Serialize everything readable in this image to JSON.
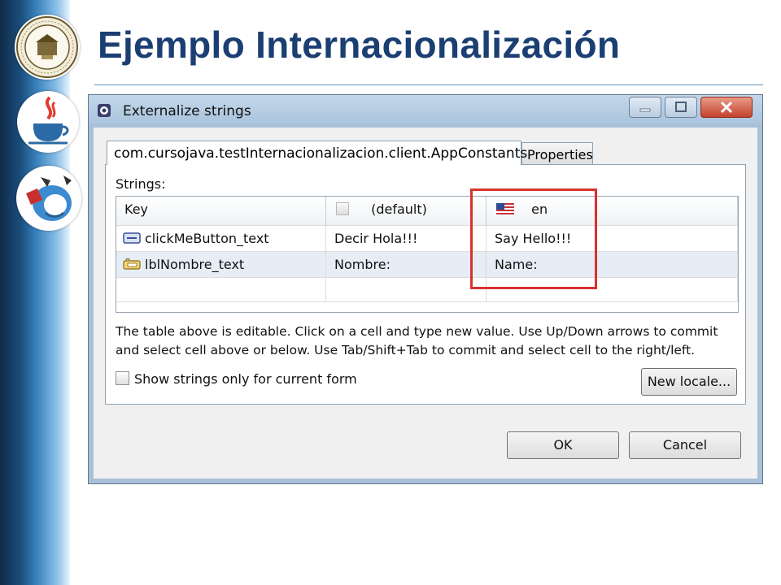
{
  "slide": {
    "title": "Ejemplo Internacionalización"
  },
  "logos": [
    {
      "name": "university-seal",
      "icon": "seal-icon"
    },
    {
      "name": "java",
      "icon": "java-cup-icon"
    },
    {
      "name": "gwt",
      "icon": "gwt-toolbox-icon"
    }
  ],
  "dialog": {
    "title": "Externalize strings",
    "window_buttons": {
      "minimize": "minimize-icon",
      "maximize": "maximize-icon",
      "close": "close-icon"
    },
    "tabs": [
      {
        "label": "com.cursojava.testInternacionalizacion.client.AppConstants",
        "active": true
      },
      {
        "label": "Properties",
        "active": false
      }
    ],
    "strings_label": "Strings:",
    "table": {
      "columns": [
        {
          "label": "Key",
          "icon": ""
        },
        {
          "label": "(default)",
          "icon": "checkbox-icon"
        },
        {
          "label": "en",
          "icon": "us-flag-icon"
        }
      ],
      "rows": [
        {
          "key": "clickMeButton_text",
          "key_icon": "button-widget-icon",
          "default": "Decir Hola!!!",
          "en": "Say Hello!!!",
          "selected": false
        },
        {
          "key": "lblNombre_text",
          "key_icon": "label-widget-icon",
          "default": "Nombre:",
          "en": "Name:",
          "selected": true
        }
      ]
    },
    "hint": "The table above is editable. Click on a cell and type new value. Use Up/Down arrows to commit and select cell above or below. Use Tab/Shift+Tab to commit and select cell to the right/left.",
    "show_only_current_form": {
      "label": "Show strings only for current form",
      "checked": false
    },
    "new_locale_label": "New locale...",
    "ok_label": "OK",
    "cancel_label": "Cancel"
  },
  "colors": {
    "title_text": "#1b3f73",
    "highlight_box": "#d7322c",
    "selected_row": "#e6edf5"
  }
}
